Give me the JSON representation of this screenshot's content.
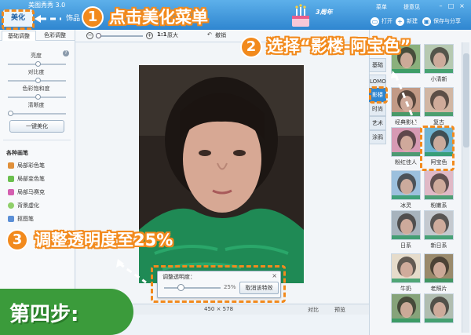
{
  "app": {
    "title": "美图秀秀 3.0",
    "tab_beautify": "美化",
    "tab_more": "饰品",
    "anniversary": "3周年"
  },
  "top_menu": {
    "menu": "菜单",
    "feedback": "提意见"
  },
  "top_actions": {
    "open": "打开",
    "new": "新建",
    "save_share": "保存与分享"
  },
  "left_tabs": [
    "基础调整",
    "色彩调整"
  ],
  "sliders": [
    {
      "label": "亮度",
      "level": 0.5
    },
    {
      "label": "对比度",
      "level": 0.5
    },
    {
      "label": "色彩饱和度",
      "level": 0.5
    },
    {
      "label": "清晰度",
      "level": 0.0
    }
  ],
  "one_key_button": "一键美化",
  "brushes": {
    "title": "各种画笔",
    "items": [
      "局部彩色笔",
      "局部变色笔",
      "局部马赛克",
      "背景虚化",
      "抠图笔"
    ]
  },
  "toolbar": {
    "ratio": "1:1",
    "original": "原大",
    "undo": "撤销"
  },
  "status": {
    "size": "450 × 578",
    "compare": "对比",
    "preview": "预览"
  },
  "popup": {
    "title": "调整透明度：",
    "value": "25%",
    "level": 0.25,
    "cancel": "取消该特效"
  },
  "right_categories": [
    "基础",
    "LOMO",
    "影楼",
    "时尚",
    "艺术",
    "涂鸦"
  ],
  "active_category": "影楼",
  "effects": [
    {
      "label": "",
      "col": 0,
      "row": 0
    },
    {
      "label": "小清新",
      "col": 1,
      "row": 0
    },
    {
      "label": "经典影楼",
      "col": 0,
      "row": 1
    },
    {
      "label": "复古",
      "col": 1,
      "row": 1
    },
    {
      "label": "粉红佳人",
      "col": 0,
      "row": 2
    },
    {
      "label": "阿宝色",
      "col": 1,
      "row": 2
    },
    {
      "label": "冰灵",
      "col": 0,
      "row": 3
    },
    {
      "label": "粉嫩系",
      "col": 1,
      "row": 3
    },
    {
      "label": "日系",
      "col": 0,
      "row": 4
    },
    {
      "label": "新日系",
      "col": 1,
      "row": 4
    },
    {
      "label": "牛奶",
      "col": 0,
      "row": 5
    },
    {
      "label": "老照片",
      "col": 1,
      "row": 5
    },
    {
      "label": "",
      "col": 0,
      "row": 6
    },
    {
      "label": "",
      "col": 1,
      "row": 6
    }
  ],
  "annotations": {
    "step1_num": "1",
    "step1_text": "点击美化菜单",
    "step2_num": "2",
    "step2_text": "选择“影楼-阿宝色”",
    "step3_num": "3",
    "step3_text": "调整透明度至25%",
    "step_label": "第四步:"
  },
  "colors": {
    "accent": "#f28a1d",
    "brand_blue": "#2f86d0",
    "step_green": "#3b9b3b"
  }
}
